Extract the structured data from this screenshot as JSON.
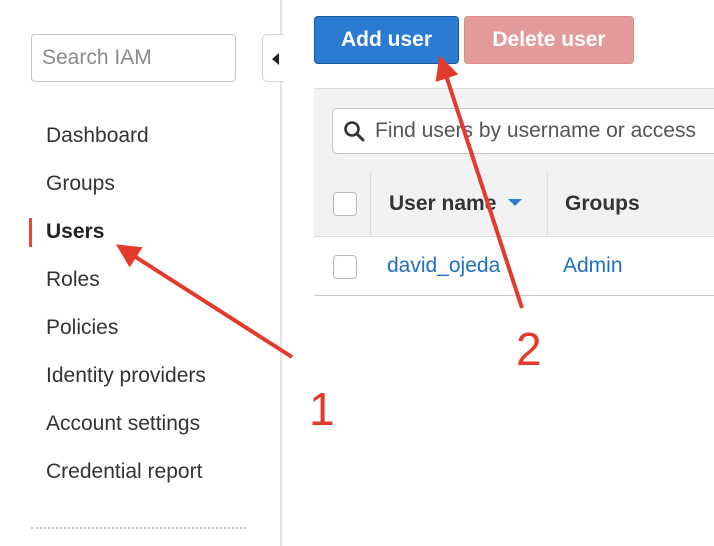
{
  "sidebar": {
    "search_placeholder": "Search IAM",
    "items": [
      {
        "label": "Dashboard"
      },
      {
        "label": "Groups"
      },
      {
        "label": "Users"
      },
      {
        "label": "Roles"
      },
      {
        "label": "Policies"
      },
      {
        "label": "Identity providers"
      },
      {
        "label": "Account settings"
      },
      {
        "label": "Credential report"
      }
    ]
  },
  "toolbar": {
    "add_user_label": "Add user",
    "delete_user_label": "Delete user"
  },
  "users_table": {
    "filter_placeholder": "Find users by username or access",
    "columns": [
      "User name",
      "Groups"
    ],
    "rows": [
      {
        "user_name": "david_ojeda",
        "groups": "Admin"
      }
    ]
  },
  "annotations": {
    "step_1": "1",
    "step_2": "2"
  },
  "colors": {
    "primary_button": "#2a7bd1",
    "disabled_danger_button": "#e39a9a",
    "link": "#1f6fc5",
    "active_marker": "#e8473c",
    "annotation": "#e33a2c"
  }
}
